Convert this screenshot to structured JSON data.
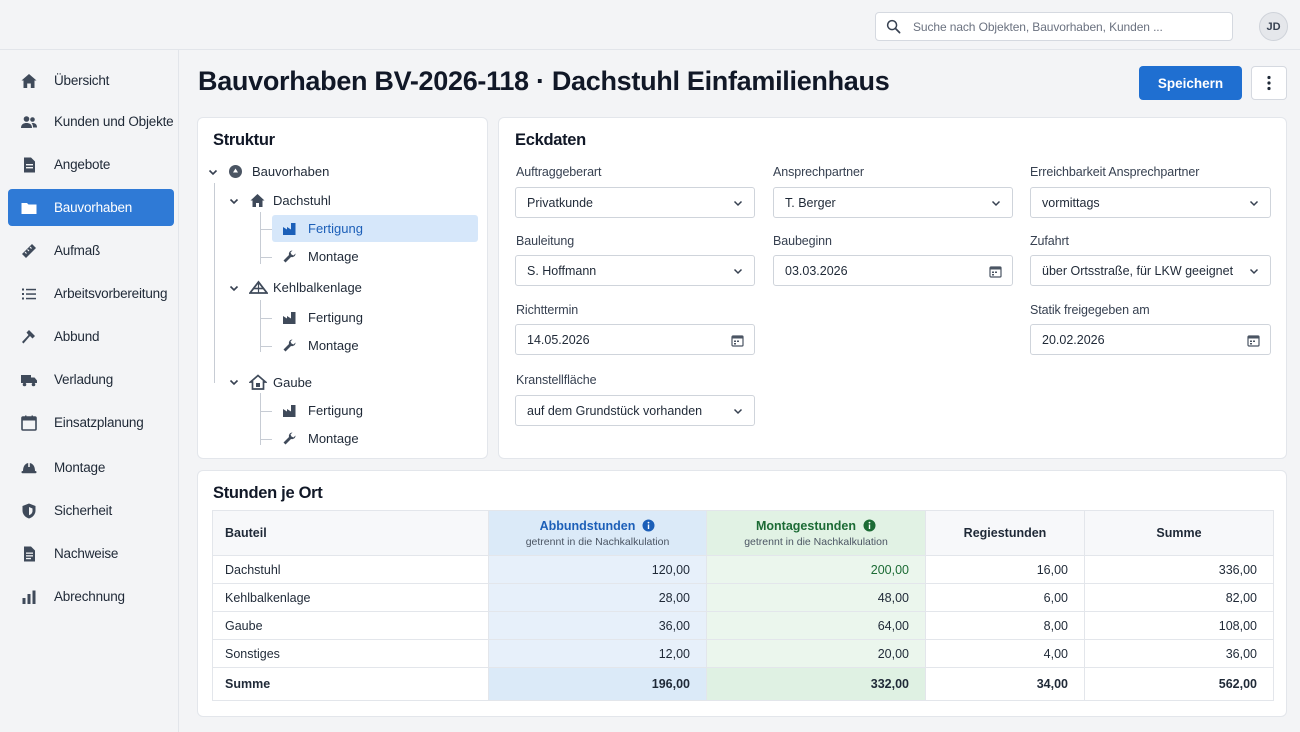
{
  "header": {
    "search_placeholder": "Suche nach Objekten, Bauvorhaben, Kunden ...",
    "user_initials": "JD"
  },
  "sidebar": {
    "items": [
      {
        "label": "Übersicht",
        "icon": "home-icon",
        "active": false
      },
      {
        "label": "Kunden und Objekte",
        "icon": "people-icon",
        "active": false
      },
      {
        "label": "Angebote",
        "icon": "document-icon",
        "active": false
      },
      {
        "label": "Bauvorhaben",
        "icon": "folder-icon",
        "active": true
      },
      {
        "label": "Aufmaß",
        "icon": "ruler-icon",
        "active": false
      },
      {
        "label": "Arbeitsvorbereitung",
        "icon": "list-icon",
        "active": false
      },
      {
        "label": "Abbund",
        "icon": "hammer-icon",
        "active": false
      },
      {
        "label": "Verladung",
        "icon": "truck-icon",
        "active": false
      },
      {
        "label": "Einsatzplanung",
        "icon": "calendar-icon",
        "active": false
      },
      {
        "label": "Montage",
        "icon": "helmet-icon",
        "active": false
      },
      {
        "label": "Sicherheit",
        "icon": "shield-icon",
        "active": false
      },
      {
        "label": "Nachweise",
        "icon": "report-icon",
        "active": false
      },
      {
        "label": "Abrechnung",
        "icon": "bar-chart-icon",
        "active": false
      }
    ]
  },
  "page": {
    "title": "Bauvorhaben BV-2026-118 · Dachstuhl Einfamilienhaus",
    "save_label": "Speichern"
  },
  "structure": {
    "title": "Struktur",
    "root": "Bauvorhaben",
    "nodes": [
      {
        "label": "Dachstuhl",
        "children": [
          "Fertigung",
          "Montage"
        ]
      },
      {
        "label": "Kehlbalkenlage",
        "children": [
          "Fertigung",
          "Montage"
        ]
      },
      {
        "label": "Gaube",
        "children": [
          "Fertigung",
          "Montage"
        ]
      }
    ],
    "selected": "Dachstuhl / Fertigung"
  },
  "eckdaten": {
    "title": "Eckdaten",
    "fields": {
      "auftraggeberart": {
        "label": "Auftraggeberart",
        "value": "Privatkunde"
      },
      "ansprechpartner": {
        "label": "Ansprechpartner",
        "value": "T. Berger"
      },
      "erreichbarkeit": {
        "label": "Erreichbarkeit Ansprechpartner",
        "value": "vormittags"
      },
      "bauleitung": {
        "label": "Bauleitung",
        "value": "S. Hoffmann"
      },
      "baubeginn": {
        "label": "Baubeginn",
        "value": "03.03.2026"
      },
      "zufahrt": {
        "label": "Zufahrt",
        "value": "über Ortsstraße, für LKW geeignet"
      },
      "richttermin": {
        "label": "Richttermin",
        "value": "14.05.2026"
      },
      "statik": {
        "label": "Statik freigegeben am",
        "value": "20.02.2026"
      },
      "kranstellflaeche": {
        "label": "Kranstellfläche",
        "value": "auf dem Grundstück vorhanden"
      }
    }
  },
  "hours": {
    "title": "Stunden je Ort",
    "columns": {
      "bauteil": "Bauteil",
      "abbund": "Abbundstunden",
      "abbund_sub": "getrennt in die Nachkalkulation",
      "montage": "Montagestunden",
      "montage_sub": "getrennt in die Nachkalkulation",
      "regie": "Regiestunden",
      "summe": "Summe"
    },
    "rows": [
      [
        "Dachstuhl",
        "120,00",
        "200,00",
        "16,00",
        "336,00"
      ],
      [
        "Kehlbalkenlage",
        "28,00",
        "48,00",
        "6,00",
        "82,00"
      ],
      [
        "Gaube",
        "36,00",
        "64,00",
        "8,00",
        "108,00"
      ],
      [
        "Sonstiges",
        "12,00",
        "20,00",
        "4,00",
        "36,00"
      ]
    ],
    "total": [
      "Summe",
      "196,00",
      "332,00",
      "34,00",
      "562,00"
    ]
  },
  "colors": {
    "accent": "#1f6fd1",
    "sidebar_active": "#2f7ad6",
    "abbund_header": "#dbeaf8",
    "montage_header": "#e1f2e4"
  }
}
